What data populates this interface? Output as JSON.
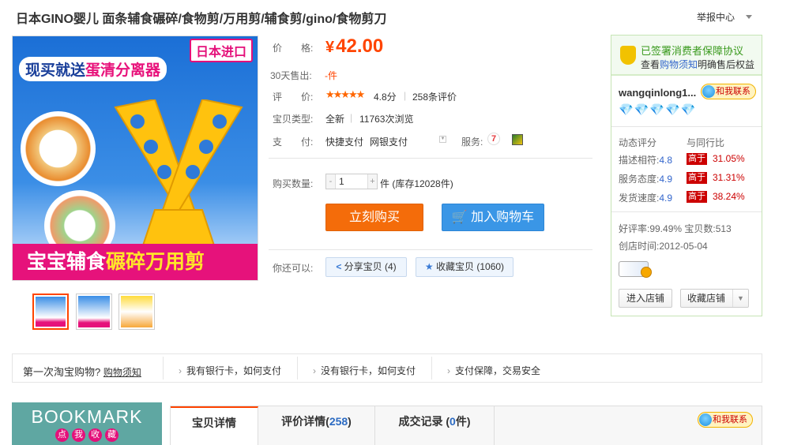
{
  "title": "日本GINO婴儿 面条辅食碾碎/食物剪/万用剪/辅食剪/gino/食物剪刀",
  "report_center": "举报中心",
  "main_image": {
    "badge": "日本进口",
    "promo_prefix": "现买就送",
    "promo_highlight": "蛋清分离器",
    "bottom_prefix": "宝宝辅食",
    "bottom_highlight": "碾碎万用剪"
  },
  "price": {
    "label": "价　　格:",
    "currency": "¥",
    "value": "42.00"
  },
  "sold": {
    "label": "30天售出:",
    "value": "-件"
  },
  "rating": {
    "label": "评　　价:",
    "stars": "★★★★★",
    "score": "4.8分",
    "sep": "|",
    "count": "258条评价"
  },
  "item_type": {
    "label": "宝贝类型:",
    "value": "全新",
    "sep": "|",
    "views": "11763次浏览"
  },
  "payment": {
    "label": "支　　付:",
    "method1": "快捷支付",
    "method2": "网银支付",
    "service_label": "服务:",
    "service_icon_text": "7"
  },
  "quantity": {
    "label": "购买数量:",
    "minus": "-",
    "value": "1",
    "plus": "+",
    "stock": "件 (库存12028件)"
  },
  "buttons": {
    "buy_now": "立刻购买",
    "add_to_cart": "加入购物车"
  },
  "share": {
    "label": "你还可以:",
    "share_btn": "分享宝贝 (4)",
    "fav_btn": "收藏宝贝 (1060)"
  },
  "seller": {
    "protect_title": "已签署消费者保障协议",
    "protect_sub_prefix": "查看",
    "protect_sub_link": "购物须知",
    "protect_sub_suffix": "明确售后权益",
    "name": "wangqinlong1...",
    "contact": "和我联系",
    "diamonds": "💎💎💎💎💎",
    "dyn_label": "动态评分",
    "peer_label": "与同行比",
    "scores": [
      {
        "label": "描述相符:",
        "value": "4.8",
        "cmp": "高于",
        "pct": "31.05%"
      },
      {
        "label": "服务态度:",
        "value": "4.9",
        "cmp": "高于",
        "pct": "31.31%"
      },
      {
        "label": "发货速度:",
        "value": "4.9",
        "cmp": "高于",
        "pct": "38.24%"
      }
    ],
    "good_rate": "好评率:99.49% 宝贝数:513",
    "created": "创店时间:2012-05-04",
    "enter_store": "进入店铺",
    "fav_store": "收藏店铺"
  },
  "help": {
    "question": "第一次淘宝购物?",
    "question_link": "购物须知",
    "items": [
      "我有银行卡，如何支付",
      "没有银行卡，如何支付",
      "支付保障，交易安全"
    ]
  },
  "bookmark": {
    "big": "BOOKMARK",
    "small": [
      "点",
      "我",
      "收",
      "藏"
    ]
  },
  "tabs": {
    "details": "宝贝详情",
    "reviews_label": "评价详情(",
    "reviews_count": "258",
    "reviews_close": ")",
    "records_label": "成交记录 (",
    "records_count": "0",
    "records_close": "件)",
    "contact": "和我联系"
  },
  "colors": {
    "accent": "#ff4400",
    "buy": "#f46c0a",
    "cart": "#3a96e6",
    "protect_green": "#3a9a1e",
    "high_red": "#cc0000"
  }
}
